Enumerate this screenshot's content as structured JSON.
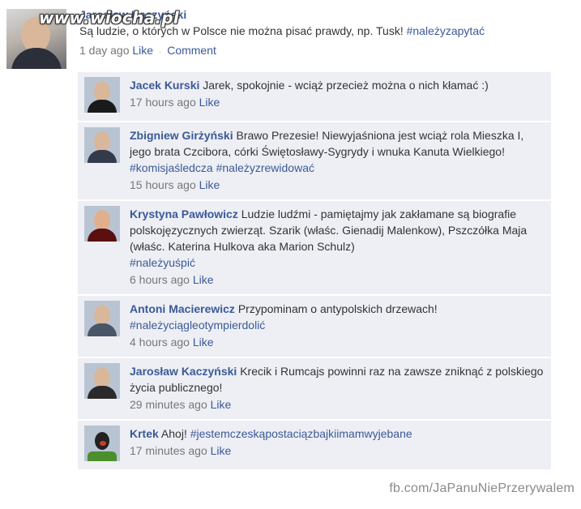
{
  "watermark": "www.wiocha.pl",
  "post": {
    "author": "Jarosław Kaczyński",
    "text": "Są ludzie, o których w Polsce nie można pisać prawdy, np. Tusk!",
    "hashtag": "#należyzapytać",
    "time": "1 day ago",
    "like_label": "Like",
    "separator": "·",
    "comment_label": "Comment"
  },
  "comments": [
    {
      "author": "Jacek Kurski",
      "text": "Jarek, spokojnie - wciąż przecież można o nich kłamać :)",
      "hashtags": "",
      "time": "17 hours ago",
      "like_label": "Like"
    },
    {
      "author": "Zbigniew Girżyński",
      "text": "Brawo Prezesie! Niewyjaśniona jest wciąż rola Mieszka I, jego brata Czcibora, córki Świętosławy-Sygrydy i wnuka Kanuta Wielkiego!",
      "hashtags": "#komisjaśledcza #należyzrewidować",
      "time": "15 hours ago",
      "like_label": "Like"
    },
    {
      "author": "Krystyna Pawłowicz",
      "text": "Ludzie ludźmi - pamiętajmy jak zakłamane są biografie polskojęzycznych zwierząt. Szarik (właśc. Gienadij Malenkow), Pszczółka Maja (właśc. Katerina Hulkova aka Marion Schulz)",
      "hashtags": "#należyuśpić",
      "time": "6 hours ago",
      "like_label": "Like"
    },
    {
      "author": "Antoni Macierewicz",
      "text": "Przypominam o antypolskich drzewach!",
      "hashtags": "#należyciągleotympierdolić",
      "time": "4 hours ago",
      "like_label": "Like"
    },
    {
      "author": "Jarosław Kaczyński",
      "text": "Krecik i Rumcajs powinni raz na zawsze zniknąć z polskiego życia publicznego!",
      "hashtags": "",
      "time": "29 minutes ago",
      "like_label": "Like"
    },
    {
      "author": "Krtek",
      "text": "Ahoj!",
      "hashtags": "#jestemczeskąpostaciązbajkiimamwyjebane",
      "time": "17 minutes ago",
      "like_label": "Like"
    }
  ],
  "footer": "fb.com/JaPanuNiePrzerywalem"
}
